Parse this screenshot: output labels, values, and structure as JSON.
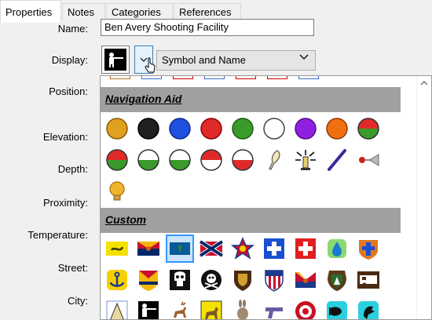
{
  "tabs": [
    {
      "label": "Properties",
      "active": true
    },
    {
      "label": "Notes",
      "active": false
    },
    {
      "label": "Categories",
      "active": false
    },
    {
      "label": "References",
      "active": false
    }
  ],
  "form": {
    "name_label": "Name:",
    "name_value": "Ben Avery Shooting Facility",
    "display_label": "Display:",
    "display_value": "Symbol and Name",
    "position_label": "Position:",
    "elevation_label": "Elevation:",
    "depth_label": "Depth:",
    "proximity_label": "Proximity:",
    "temperature_label": "Temperature:",
    "street_label": "Street:",
    "city_label": "City:"
  },
  "symbol_picker": {
    "sections": [
      {
        "title": "Navigation Aid",
        "icons": [
          "amber-circle-icon",
          "black-circle-icon",
          "blue-circle-icon",
          "red-circle-icon",
          "green-circle-icon",
          "white-circle-icon",
          "violet-circle-icon",
          "orange-circle-icon",
          "red-green-circle-icon",
          "green-red-circle-icon",
          "white-green-circle-icon",
          "green-white-circle-icon",
          "white-red-circle-icon",
          "red-white-circle-icon",
          "feather-icon",
          "light-beacon-icon",
          "daymark-stick-icon",
          "horn-icon",
          "bulb-icon"
        ]
      },
      {
        "title": "Custom",
        "icons": [
          "gadsden-flag-icon",
          "arizona-flag-icon",
          "vermont-flag-icon",
          "confederate-flag-icon",
          "vfw-emblem-icon",
          "blue-cross-icon",
          "swiss-cross-icon",
          "water-drop-icon",
          "shield-cross-icon",
          "anchor-icon",
          "arizona-emblem-icon",
          "skull-icon",
          "skull-crossbones-icon",
          "shield-icon",
          "stripes-shield-icon",
          "arizona-shield-icon",
          "park-service-icon",
          "rv-camper-icon",
          "tipi-icon",
          "shooter-icon",
          "deer-icon",
          "moose-icon",
          "rabbit-icon",
          "pistol-icon",
          "shooting-range-icon",
          "fish-icon",
          "bird-icon"
        ]
      }
    ],
    "selected_icon": "vermont-flag-icon",
    "colors": {
      "section_bg": "#a0a0a0",
      "selection": "#cce4ff"
    }
  }
}
